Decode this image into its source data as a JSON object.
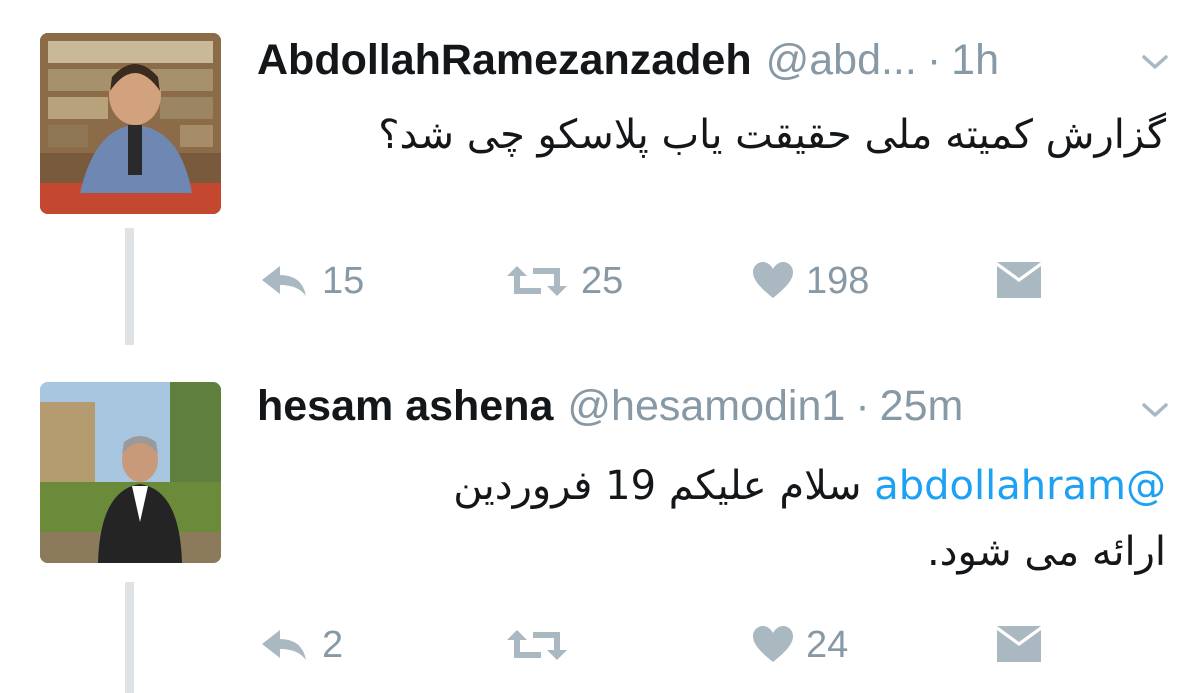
{
  "tweets": [
    {
      "name": "AbdollahRamezanzadeh",
      "handle": "@abd...",
      "separator": "·",
      "time": "1h",
      "text_lines": [
        "گزارش کمیته ملی حقیقت یاب پلاسکو چی شد؟"
      ],
      "reply_count": "15",
      "retweet_count": "25",
      "like_count": "198",
      "avatar_icon": "person-avatar-bookshelf"
    },
    {
      "name": "hesam ashena",
      "handle": "@hesamodin1",
      "separator": "·",
      "time": "25m",
      "mention": "@abdollahram",
      "text_line1_rest": "سلام علیکم 19 فروردین",
      "text_line2": "ارائه می شود.",
      "reply_count": "2",
      "like_count": "24",
      "avatar_icon": "person-avatar-outdoor"
    }
  ],
  "colors": {
    "name": "#14171a",
    "meta": "#8899a6",
    "mention": "#1da1f2",
    "icon": "#aab8c2",
    "thread_line": "#dfe3e6"
  }
}
